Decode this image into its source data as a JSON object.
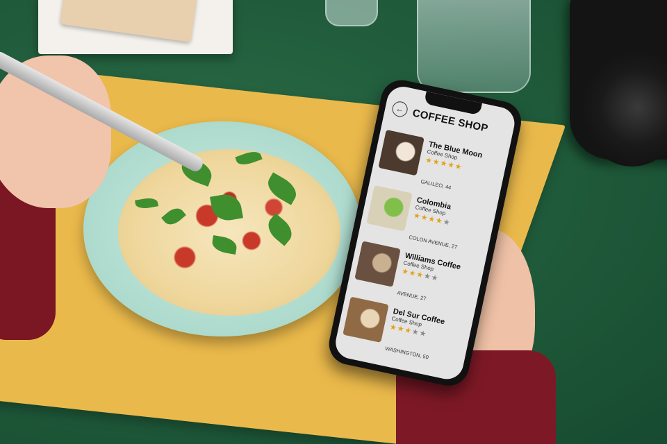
{
  "app": {
    "title": "COFFEE SHOP",
    "back_icon": "arrow-left-icon"
  },
  "shops": [
    {
      "name": "The Blue Moon",
      "type": "Coffee Shop",
      "rating": 5,
      "address": "GALILEO, 44",
      "thumb": "cake-and-coffee-photo",
      "thumb_colors": [
        "#4b3a2d",
        "#f2e6d8"
      ]
    },
    {
      "name": "Colombia",
      "type": "Coffee Shop",
      "rating": 4,
      "address": "COLON AVENUE, 27",
      "thumb": "green-cup-photo",
      "thumb_colors": [
        "#d8d1b8",
        "#7fbf4a"
      ]
    },
    {
      "name": "Williams Coffee",
      "type": "Coffee Shop",
      "rating": 3,
      "address": "AVENUE, 27",
      "thumb": "barista-photo",
      "thumb_colors": [
        "#6a5040",
        "#c9b090"
      ]
    },
    {
      "name": "Del Sur Coffee",
      "type": "Coffee Shop",
      "rating": 3,
      "address": "WASHINGTON, 50",
      "thumb": "latte-art-photo",
      "thumb_colors": [
        "#8f6a45",
        "#e9d6b6"
      ]
    }
  ],
  "colors": {
    "star_on": "#e2a31a",
    "star_off": "#8a8a8a",
    "screen_bg": "#e4e4e4"
  }
}
